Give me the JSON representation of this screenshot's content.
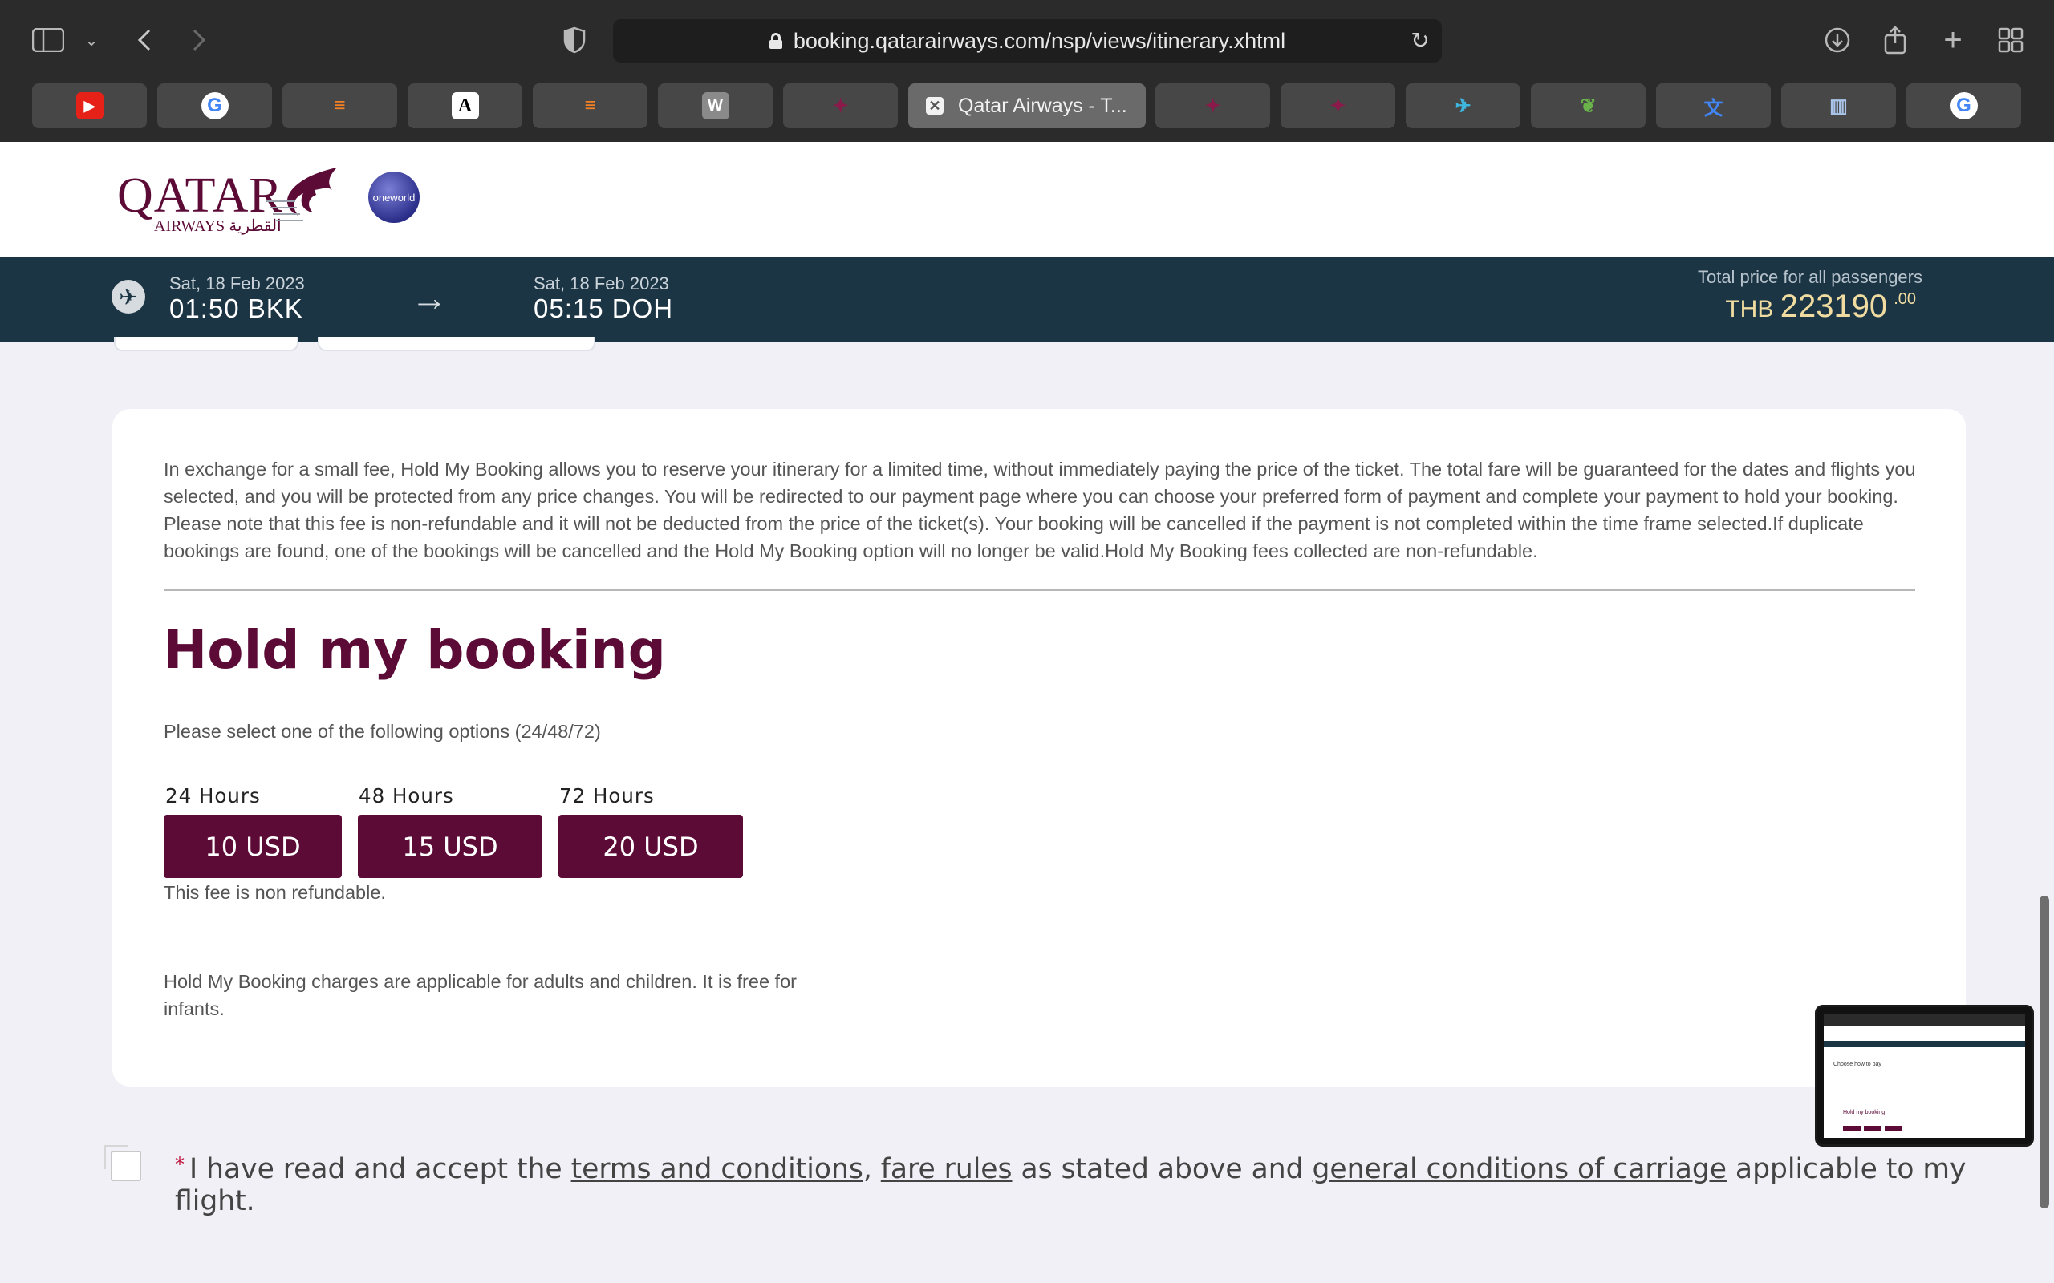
{
  "browser": {
    "url": "booking.qatarairways.com/nsp/views/itinerary.xhtml",
    "active_tab_title": "Qatar Airways - T...",
    "tabs": [
      {
        "icon": "youtube-icon",
        "glyph": "▶",
        "color": "#e62117"
      },
      {
        "icon": "google-icon",
        "glyph": "G",
        "color": "#4285f4"
      },
      {
        "icon": "stackoverflow-icon",
        "glyph": "≡",
        "color": "#f48024"
      },
      {
        "icon": "font-a-icon",
        "glyph": "A",
        "color": "#ffffff"
      },
      {
        "icon": "stackoverflow-icon",
        "glyph": "≡",
        "color": "#f48024"
      },
      {
        "icon": "w-icon",
        "glyph": "W",
        "color": "#bdbdbd"
      },
      {
        "icon": "qatar-oryx-icon",
        "glyph": "✦",
        "color": "#8a1a4a"
      },
      {
        "icon": "close-icon",
        "glyph": "✕",
        "color": "#ffffff"
      },
      {
        "icon": "qatar-oryx-icon",
        "glyph": "✦",
        "color": "#8a1a4a"
      },
      {
        "icon": "qatar-oryx-icon",
        "glyph": "✦",
        "color": "#8a1a4a"
      },
      {
        "icon": "bird-icon",
        "glyph": "✈",
        "color": "#3fb6e0"
      },
      {
        "icon": "leaf-icon",
        "glyph": "❦",
        "color": "#6ab34a"
      },
      {
        "icon": "translate-icon",
        "glyph": "文",
        "color": "#4285f4"
      },
      {
        "icon": "columns-icon",
        "glyph": "▥",
        "color": "#a9c4e8"
      },
      {
        "icon": "google-icon",
        "glyph": "G",
        "color": "#4285f4"
      }
    ]
  },
  "site": {
    "logo_text": "QATAR",
    "logo_sub": "AIRWAYS القطرية",
    "oneworld": "oneworld"
  },
  "flight": {
    "depart_date": "Sat, 18 Feb 2023",
    "depart_time": "01:50 BKK",
    "arrive_date": "Sat, 18 Feb 2023",
    "arrive_time": "05:15 DOH",
    "total_label": "Total price for all passengers",
    "currency": "THB",
    "amount": "223190",
    "cents": ".00"
  },
  "hold": {
    "intro": "In exchange for a small fee, Hold My Booking allows you to reserve your itinerary for a limited time, without immediately paying the price of the ticket. The total fare will be guaranteed for the dates and flights you selected, and you will be protected from any price changes. You will be redirected to our payment page where you can choose your preferred form of payment and complete your payment to hold your booking. Please note that this fee is non-refundable and it will not be deducted from the price of the ticket(s). Your booking will be cancelled if the payment is not completed within the time frame selected.If duplicate bookings are found, one of the bookings will be cancelled and the Hold My Booking option will no longer be valid.Hold My Booking fees collected are non-refundable.",
    "title": "Hold my booking",
    "select_text": "Please select one of the following options (24/48/72)",
    "options": [
      {
        "label": "24 Hours",
        "price": "10 USD"
      },
      {
        "label": "48 Hours",
        "price": "15 USD"
      },
      {
        "label": "72 Hours",
        "price": "20 USD"
      }
    ],
    "fee_note": "This fee is non refundable.",
    "charges_note": "Hold My Booking charges are applicable for adults and children. It is free for infants."
  },
  "terms": {
    "required_mark": "*",
    "prefix": "I have read and accept the ",
    "link1": "terms and conditions",
    "sep1": ", ",
    "link2": "fare rules",
    "mid": " as stated above and ",
    "link3": "general conditions of carriage",
    "suffix": " applicable to my flight."
  },
  "thumbnail": {
    "text1": "Choose how to pay",
    "text2": "Hold my booking"
  },
  "colors": {
    "brand": "#5c0a36",
    "flightbar": "#1b3544",
    "price": "#f0dca0"
  }
}
